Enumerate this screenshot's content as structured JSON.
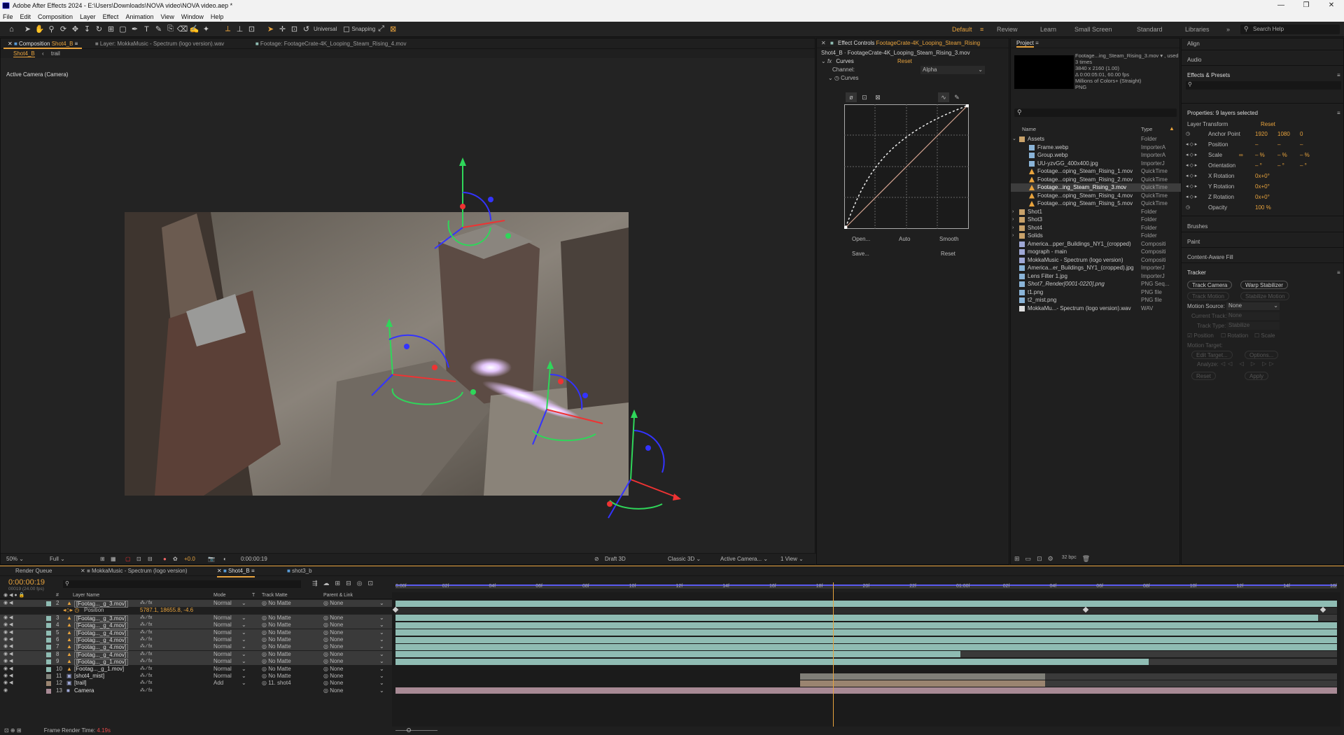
{
  "window": {
    "title": "Adobe After Effects 2024 - E:\\Users\\Downloads\\NOVA video\\NOVA video.aep *"
  },
  "menu": [
    "File",
    "Edit",
    "Composition",
    "Layer",
    "Effect",
    "Animation",
    "View",
    "Window",
    "Help"
  ],
  "toolbar": {
    "universal": "Universal",
    "snapping": "Snapping"
  },
  "workspaces": {
    "default": "Default",
    "review": "Review",
    "learn": "Learn",
    "small_screen": "Small Screen",
    "standard": "Standard",
    "libraries": "Libraries",
    "search": "Search Help"
  },
  "comp_panel": {
    "tab_composition": "Composition",
    "tab_comp_name": "Shot4_B",
    "tab_layer": "Layer: MokkaMusic - Spectrum (logo version).wav",
    "tab_footage": "Footage: FootageCrate-4K_Looping_Steam_Rising_4.mov",
    "crumb_1": "Shot4_B",
    "crumb_2": "trail",
    "camera_label": "Active Camera (Camera)",
    "zoom": "50%",
    "resolution": "Full",
    "exposure": "+0.0",
    "timecode": "0:00:00:19",
    "draft3d": "Draft 3D",
    "renderer": "Classic 3D",
    "view_camera": "Active Camera...",
    "views": "1 View"
  },
  "effect_controls": {
    "tab_label": "Effect Controls",
    "tab_target": "FootageCrate-4K_Looping_Steam_Rising",
    "source": "Shot4_B · FootageCrate-4K_Looping_Steam_Rising_3.mov",
    "fx_name": "Curves",
    "reset": "Reset",
    "channel_label": "Channel:",
    "channel_value": "Alpha",
    "curves_label": "Curves",
    "btn_open": "Open...",
    "btn_auto": "Auto",
    "btn_smooth": "Smooth",
    "btn_save": "Save...",
    "btn_reset": "Reset"
  },
  "project": {
    "tab": "Project",
    "preview_name": "Footage...ing_Steam_Rising_3.mov ▾ , used 3 times",
    "preview_res": "3840 x 2160 (1.00)",
    "preview_dur": "Δ 0:00:05:01, 60.00 fps",
    "preview_colors": "Millions of Colors+ (Straight)",
    "preview_codec": "PNG",
    "col_name": "Name",
    "col_type": "Type",
    "bpc": "32 bpc",
    "items": [
      {
        "name": "Assets",
        "type": "Folder",
        "indent": 0,
        "kind": "folder",
        "open": true
      },
      {
        "name": "Frame.webp",
        "type": "ImporterA",
        "indent": 1,
        "kind": "image"
      },
      {
        "name": "Group.webp",
        "type": "ImporterA",
        "indent": 1,
        "kind": "image"
      },
      {
        "name": "UU-yzvGG_400x400.jpg",
        "type": "ImporterJ",
        "indent": 1,
        "kind": "image"
      },
      {
        "name": "Footage...oping_Steam_Rising_1.mov",
        "type": "QuickTime",
        "indent": 1,
        "kind": "footage"
      },
      {
        "name": "Footage...oping_Steam_Rising_2.mov",
        "type": "QuickTime",
        "indent": 1,
        "kind": "footage"
      },
      {
        "name": "Footage...ing_Steam_Rising_3.mov",
        "type": "QuickTime",
        "indent": 1,
        "kind": "footage",
        "selected": true
      },
      {
        "name": "Footage...oping_Steam_Rising_4.mov",
        "type": "QuickTime",
        "indent": 1,
        "kind": "footage"
      },
      {
        "name": "Footage...oping_Steam_Rising_5.mov",
        "type": "QuickTime",
        "indent": 1,
        "kind": "footage"
      },
      {
        "name": "Shot1",
        "type": "Folder",
        "indent": 0,
        "kind": "folder"
      },
      {
        "name": "Shot3",
        "type": "Folder",
        "indent": 0,
        "kind": "folder"
      },
      {
        "name": "Shot4",
        "type": "Folder",
        "indent": 0,
        "kind": "folder"
      },
      {
        "name": "Solids",
        "type": "Folder",
        "indent": 0,
        "kind": "folder"
      },
      {
        "name": "America...pper_Buildings_NY1_(cropped)",
        "type": "Compositi",
        "indent": 0,
        "kind": "comp"
      },
      {
        "name": "mograph - main",
        "type": "Compositi",
        "indent": 0,
        "kind": "comp"
      },
      {
        "name": "MokkaMusic - Spectrum (logo version)",
        "type": "Compositi",
        "indent": 0,
        "kind": "comp"
      },
      {
        "name": "America...er_Buildings_NY1_(cropped).jpg",
        "type": "ImporterJ",
        "indent": 0,
        "kind": "image"
      },
      {
        "name": "Lens Filter 1.jpg",
        "type": "ImporterJ",
        "indent": 0,
        "kind": "image"
      },
      {
        "name": "Shot7_Render[0001-0220].png",
        "type": "PNG Seq...",
        "indent": 0,
        "kind": "image",
        "italic": true
      },
      {
        "name": "t1.png",
        "type": "PNG file",
        "indent": 0,
        "kind": "image"
      },
      {
        "name": "t2_mist.png",
        "type": "PNG file",
        "indent": 0,
        "kind": "image"
      },
      {
        "name": "MokkaMu...- Spectrum (logo version).wav",
        "type": "WAV",
        "indent": 0,
        "kind": "audio"
      }
    ]
  },
  "right_panel": {
    "align": "Align",
    "audio": "Audio",
    "effects_presets": "Effects & Presets",
    "properties_title": "Properties: 9 layers selected",
    "layer_transform": "Layer Transform",
    "reset": "Reset",
    "props": [
      {
        "name": "Anchor Point",
        "v1": "1920",
        "v2": "1080",
        "v3": "0"
      },
      {
        "name": "Position",
        "v1": "–",
        "v2": "–",
        "v3": "–"
      },
      {
        "name": "Scale",
        "v1": "– %",
        "v2": "– %",
        "v3": "– %"
      },
      {
        "name": "Orientation",
        "v1": "– °",
        "v2": "– °",
        "v3": "– °"
      },
      {
        "name": "X Rotation",
        "v1": "0x+0°",
        "v2": "",
        "v3": ""
      },
      {
        "name": "Y Rotation",
        "v1": "0x+0°",
        "v2": "",
        "v3": ""
      },
      {
        "name": "Z Rotation",
        "v1": "0x+0°",
        "v2": "",
        "v3": ""
      },
      {
        "name": "Opacity",
        "v1": "100 %",
        "v2": "",
        "v3": ""
      }
    ],
    "brushes": "Brushes",
    "paint": "Paint",
    "content_aware": "Content-Aware Fill",
    "tracker": "Tracker",
    "track_camera": "Track Camera",
    "warp_stabilizer": "Warp Stabilizer",
    "track_motion": "Track Motion",
    "stabilize_motion": "Stabilize Motion",
    "motion_source_label": "Motion Source:",
    "motion_source_value": "None",
    "current_track": "Current Track:",
    "current_track_value": "None",
    "track_type": "Track Type:",
    "track_type_value": "Stabilize",
    "cb_position": "Position",
    "cb_rotation": "Rotation",
    "cb_scale": "Scale",
    "motion_target": "Motion Target:",
    "edit_target": "Edit Target...",
    "options": "Options...",
    "analyze": "Analyze:",
    "btn_reset": "Reset",
    "btn_apply": "Apply"
  },
  "timeline": {
    "tab_render": "Render Queue",
    "tab_mokka": "MokkaMusic - Spectrum (logo version)",
    "tab_shot4b": "Shot4_B",
    "tab_shot3b": "shot3_b",
    "timecode": "0:00:00:19",
    "frame_info": "00019 (24.00 fps)",
    "col_layer_name": "Layer Name",
    "col_mode": "Mode",
    "col_t": "T",
    "col_trackmatte": "Track Matte",
    "col_parent": "Parent & Link",
    "ruler": [
      "0:00f",
      "02f",
      "04f",
      "06f",
      "08f",
      "10f",
      "12f",
      "14f",
      "16f",
      "18f",
      "20f",
      "22f",
      "01:00f",
      "02f",
      "04f",
      "06f",
      "08f",
      "10f",
      "12f",
      "14f",
      "16f"
    ],
    "position_label": "Position",
    "position_value": "5787.1, 18655.8, -4.6",
    "layers": [
      {
        "num": "2",
        "name": "[Footag..._g_3.mov]",
        "mode": "Normal",
        "matte": "No Matte",
        "parent": "None",
        "kind": "footage",
        "selected": true,
        "start": 0.0,
        "end": 1.0,
        "color": "#8fbcb3"
      },
      {
        "num": "3",
        "name": "[Footag..._g_3.mov]",
        "mode": "Normal",
        "matte": "No Matte",
        "parent": "None",
        "kind": "footage",
        "selected": true,
        "start": 0.0,
        "end": 0.98,
        "color": "#8fbcb3"
      },
      {
        "num": "4",
        "name": "[Footag..._g_4.mov]",
        "mode": "Normal",
        "matte": "No Matte",
        "parent": "None",
        "kind": "footage",
        "selected": true,
        "start": 0.0,
        "end": 1.0,
        "color": "#8fbcb3"
      },
      {
        "num": "5",
        "name": "[Footag..._g_4.mov]",
        "mode": "Normal",
        "matte": "No Matte",
        "parent": "None",
        "kind": "footage",
        "selected": true,
        "start": 0.0,
        "end": 1.0,
        "color": "#8fbcb3"
      },
      {
        "num": "6",
        "name": "[Footag..._g_4.mov]",
        "mode": "Normal",
        "matte": "No Matte",
        "parent": "None",
        "kind": "footage",
        "selected": true,
        "start": 0.0,
        "end": 1.0,
        "color": "#8fbcb3"
      },
      {
        "num": "7",
        "name": "[Footag..._g_4.mov]",
        "mode": "Normal",
        "matte": "No Matte",
        "parent": "None",
        "kind": "footage",
        "selected": true,
        "start": 0.0,
        "end": 1.0,
        "color": "#8fbcb3"
      },
      {
        "num": "8",
        "name": "[Footag..._g_4.mov]",
        "mode": "Normal",
        "matte": "No Matte",
        "parent": "None",
        "kind": "footage",
        "selected": true,
        "start": 0.0,
        "end": 0.6,
        "color": "#8fbcb3"
      },
      {
        "num": "9",
        "name": "[Footag..._g_1.mov]",
        "mode": "Normal",
        "matte": "No Matte",
        "parent": "None",
        "kind": "footage",
        "selected": true,
        "start": 0.0,
        "end": 0.8,
        "color": "#8fbcb3"
      },
      {
        "num": "10",
        "name": "[Footag..._g_1.mov]",
        "mode": "Normal",
        "matte": "No Matte",
        "parent": "None",
        "kind": "footage",
        "selected": false,
        "start": 0.0,
        "end": 0.0,
        "color": "#8fbcb3"
      },
      {
        "num": "11",
        "name": "[shot4_mist]",
        "mode": "Normal",
        "matte": "No Matte",
        "parent": "None",
        "kind": "comp",
        "selected": false,
        "start": 0.43,
        "end": 0.69,
        "color": "#7f7f78"
      },
      {
        "num": "12",
        "name": "[trail]",
        "mode": "Add",
        "matte": "11. shot4",
        "parent": "None",
        "kind": "comp",
        "selected": false,
        "start": 0.43,
        "end": 0.69,
        "color": "#9a8470"
      },
      {
        "num": "13",
        "name": "Camera",
        "mode": "",
        "matte": "",
        "parent": "None",
        "kind": "camera",
        "selected": false,
        "start": 0.0,
        "end": 1.0,
        "color": "#a88a95"
      }
    ],
    "frame_render_label": "Frame Render Time:",
    "frame_render_value": "4.19s",
    "playhead": 0.465
  }
}
